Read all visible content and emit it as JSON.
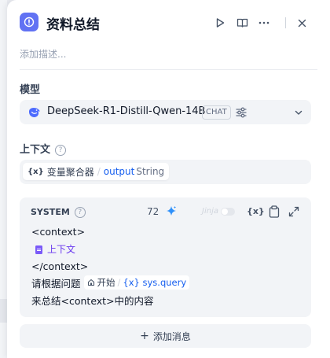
{
  "node": {
    "title": "资料总结",
    "description_placeholder": "添加描述..."
  },
  "model": {
    "label": "模型",
    "name": "DeepSeek-R1-Distill-Qwen-14B",
    "mode_badge": "CHAT"
  },
  "context": {
    "label": "上下文",
    "variable": {
      "node": "变量聚合器",
      "name": "output",
      "type": "String"
    }
  },
  "prompt": {
    "role": "SYSTEM",
    "token_count": "72",
    "jinja_label": "Jinja",
    "lines": {
      "l1": "<context>",
      "context_chip": "上下文",
      "l3": "</context>",
      "l4_prefix": "请根据问题",
      "sys_start": "开始",
      "sys_var": "sys.query",
      "l5": "来总结<context>中的内容"
    }
  },
  "add_message": {
    "label": "添加消息"
  },
  "colors": {
    "accent": "#155eef",
    "app_icon": "#6172f3",
    "context_chip": "#6938ef"
  }
}
